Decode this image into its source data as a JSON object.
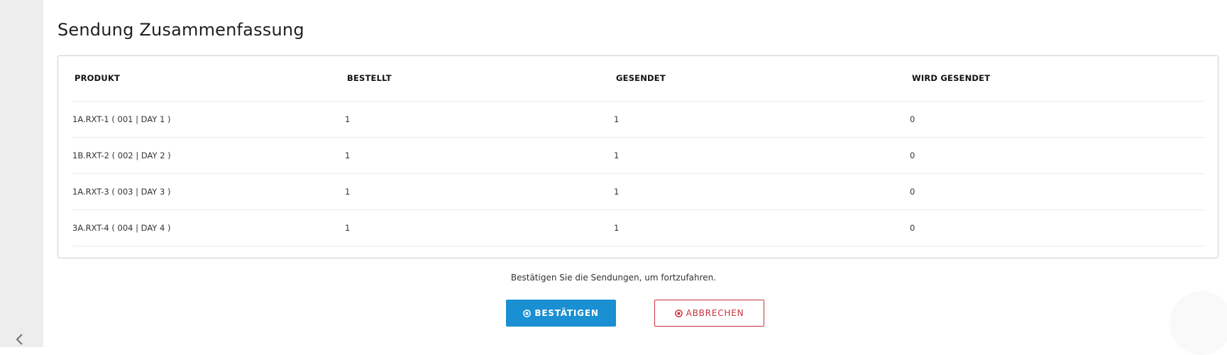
{
  "page": {
    "title": "Sendung Zusammenfassung"
  },
  "table": {
    "headers": {
      "product": "PRODUKT",
      "ordered": "BESTELLT",
      "sent": "GESENDET",
      "to_send": "WIRD GESENDET"
    },
    "rows": [
      {
        "product": "1A.RXT-1 ( 001 | DAY 1 )",
        "ordered": "1",
        "sent": "1",
        "to_send": "0"
      },
      {
        "product": "1B.RXT-2 ( 002 | DAY 2 )",
        "ordered": "1",
        "sent": "1",
        "to_send": "0"
      },
      {
        "product": "1A.RXT-3 ( 003 | DAY 3 )",
        "ordered": "1",
        "sent": "1",
        "to_send": "0"
      },
      {
        "product": "3A.RXT-4 ( 004 | DAY 4 )",
        "ordered": "1",
        "sent": "1",
        "to_send": "0"
      }
    ]
  },
  "confirmation": {
    "message": "Bestätigen Sie die Sendungen, um fortzufahren.",
    "confirm_label": "BESTÄTIGEN",
    "cancel_label": "ABBRECHEN",
    "confirm_icon": "check-circle-icon",
    "cancel_icon": "close-circle-icon"
  },
  "sidebar": {
    "toggle_icon": "chevron-left-icon"
  },
  "colors": {
    "primary": "#1a8fd1",
    "danger": "#c9303c",
    "sidebar": "#ededed"
  }
}
